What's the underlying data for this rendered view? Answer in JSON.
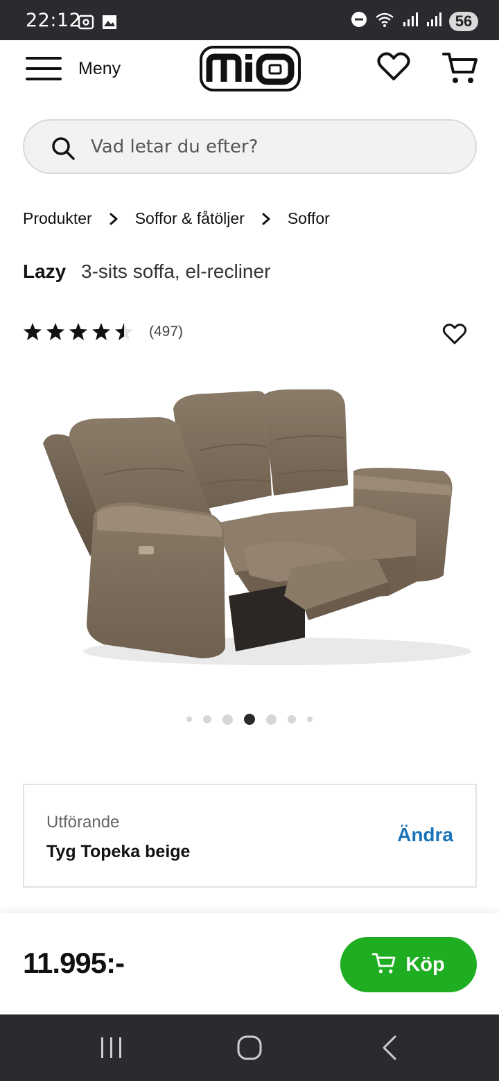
{
  "status_bar": {
    "time": "22:12",
    "battery": "56",
    "icons": [
      "screenshot-icon",
      "gallery-icon",
      "dnd-icon",
      "wifi-icon",
      "signal-icon",
      "signal-icon",
      "battery-icon"
    ]
  },
  "header": {
    "menu_label": "Meny",
    "logo_text": "mio"
  },
  "search": {
    "placeholder": "Vad letar du efter?"
  },
  "breadcrumb": [
    "Produkter",
    "Soffor & fåtöljer",
    "Soffor"
  ],
  "product": {
    "brand": "Lazy",
    "description": "3-sits soffa, el-recliner",
    "rating": 4.5,
    "rating_max": 5,
    "review_count": "(497)",
    "image_alt": "brown 3-seat recliner sofa"
  },
  "carousel": {
    "total": 7,
    "active_index": 3
  },
  "variant": {
    "label": "Utförande",
    "value": "Tyg Topeka beige",
    "change_label": "Ändra"
  },
  "purchase": {
    "price": "11.995:-",
    "buy_label": "Köp"
  },
  "colors": {
    "accent_green": "#1fae22",
    "link_blue": "#1a73b8",
    "system_bar": "#2a2b2f"
  }
}
